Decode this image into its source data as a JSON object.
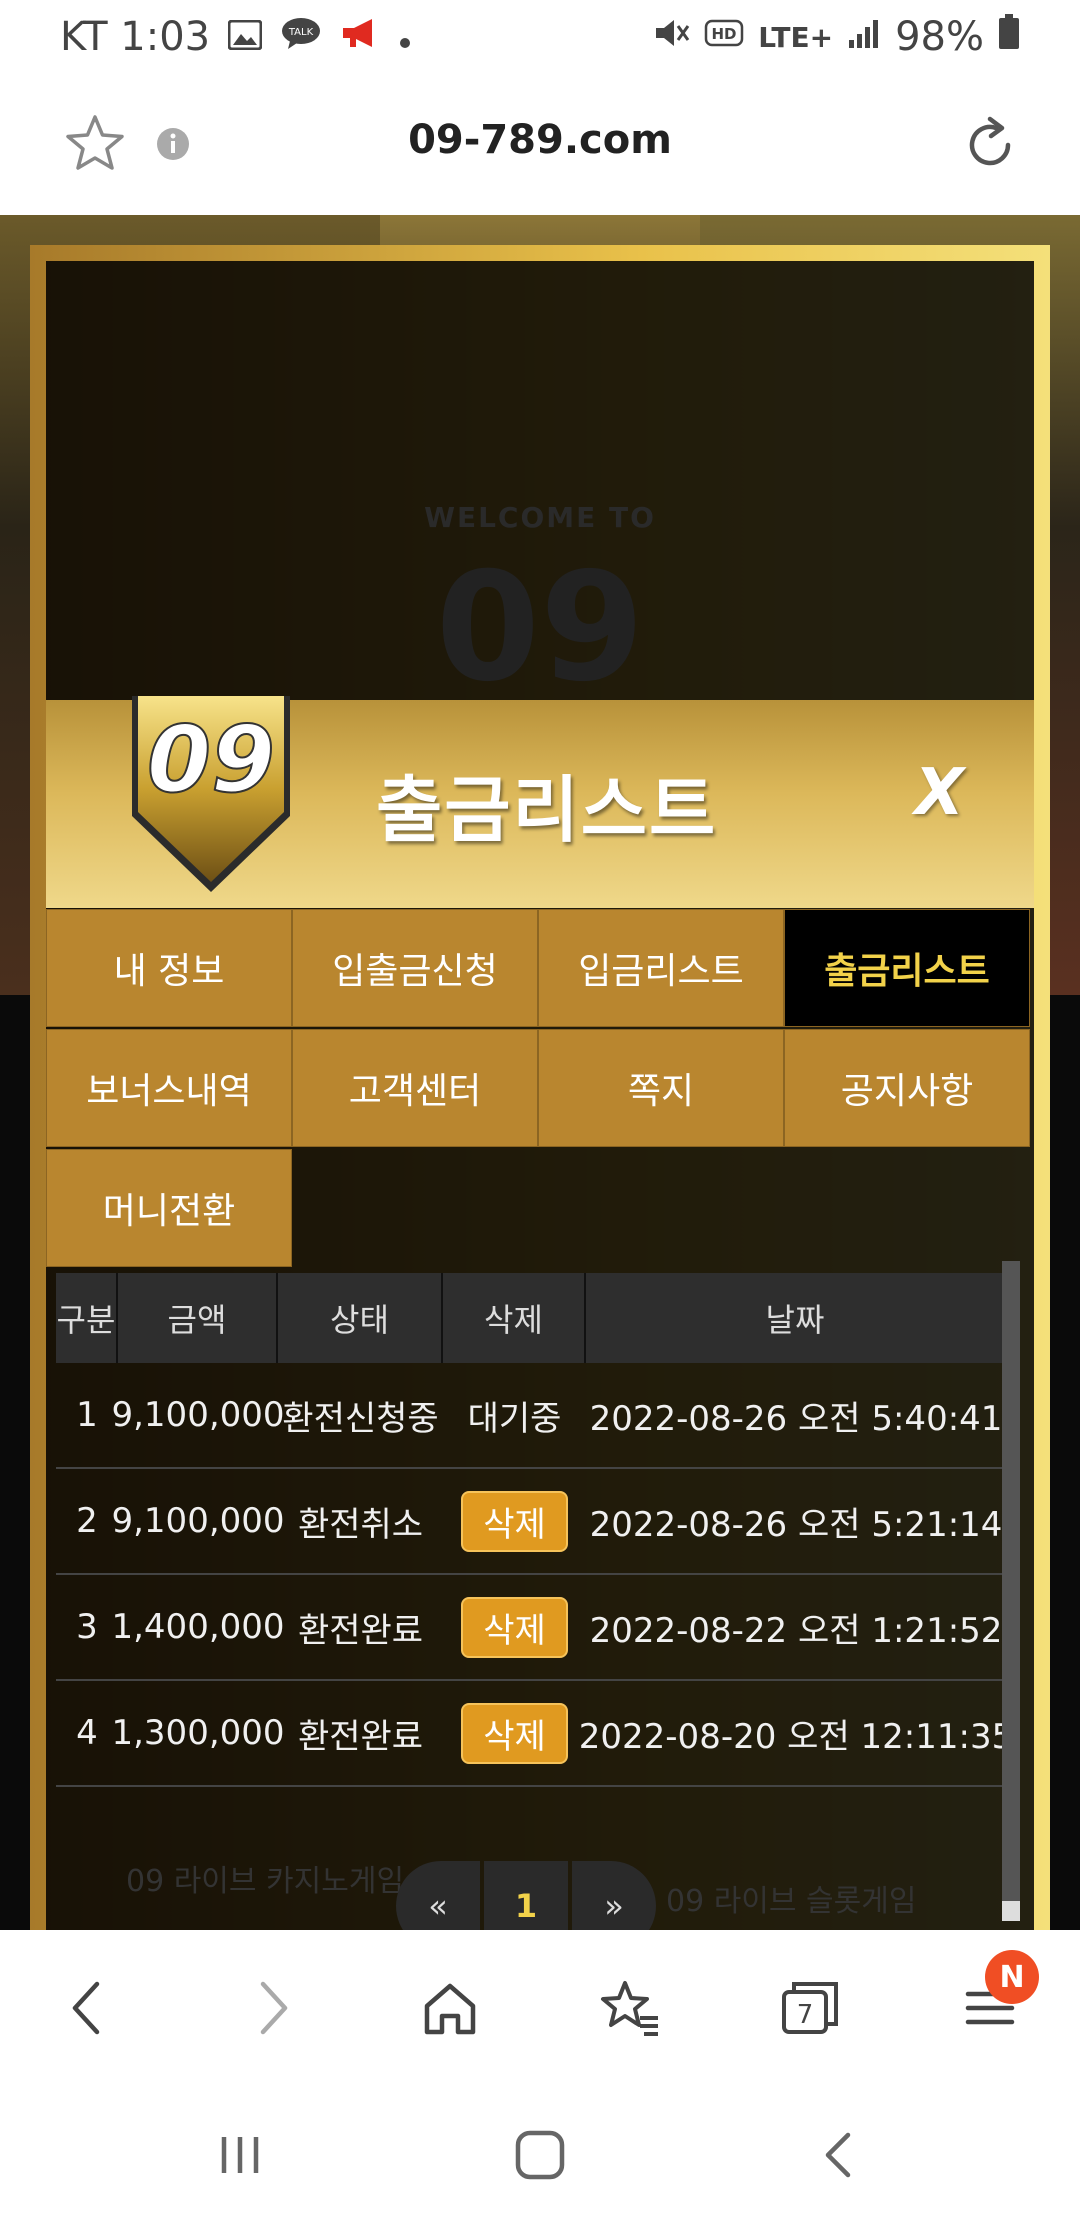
{
  "status_bar": {
    "carrier_time": "KT 1:03",
    "network": "LTE+",
    "battery": "98%"
  },
  "browser": {
    "url": "09-789.com",
    "tabs_count": "7",
    "menu_badge": "N"
  },
  "page_bg": {
    "welcome": "WELCOME TO",
    "welcome_big": "09",
    "footer_left": "09 라이브 카지노게임",
    "footer_right": "09 라이브 슬롯게임"
  },
  "modal": {
    "logo": "09",
    "title": "출금리스트",
    "close": "X",
    "tabs": [
      {
        "label": "내 정보"
      },
      {
        "label": "입출금신청"
      },
      {
        "label": "입금리스트"
      },
      {
        "label": "출금리스트"
      },
      {
        "label": "보너스내역"
      },
      {
        "label": "고객센터"
      },
      {
        "label": "쪽지"
      },
      {
        "label": "공지사항"
      },
      {
        "label": "머니전환"
      }
    ],
    "active_tab": "출금리스트",
    "table": {
      "headers": [
        "구분",
        "금액",
        "상태",
        "삭제",
        "날짜"
      ],
      "rows": [
        {
          "no": "1",
          "amount": "9,100,000",
          "status": "환전신청중",
          "action": "대기중",
          "date": "2022-08-26 오전 5:40:41"
        },
        {
          "no": "2",
          "amount": "9,100,000",
          "status": "환전취소",
          "action": "삭제",
          "date": "2022-08-26 오전 5:21:14"
        },
        {
          "no": "3",
          "amount": "1,400,000",
          "status": "환전완료",
          "action": "삭제",
          "date": "2022-08-22 오전 1:21:52"
        },
        {
          "no": "4",
          "amount": "1,300,000",
          "status": "환전완료",
          "action": "삭제",
          "date": "2022-08-20 오전 12:11:35"
        }
      ]
    },
    "pagination": {
      "prev": "«",
      "current": "1",
      "next": "»"
    }
  },
  "colors": {
    "gold": "#b9862f",
    "active_tab_text": "#f2d24a",
    "delete_button": "#e09a20",
    "badge": "#f04e24"
  }
}
